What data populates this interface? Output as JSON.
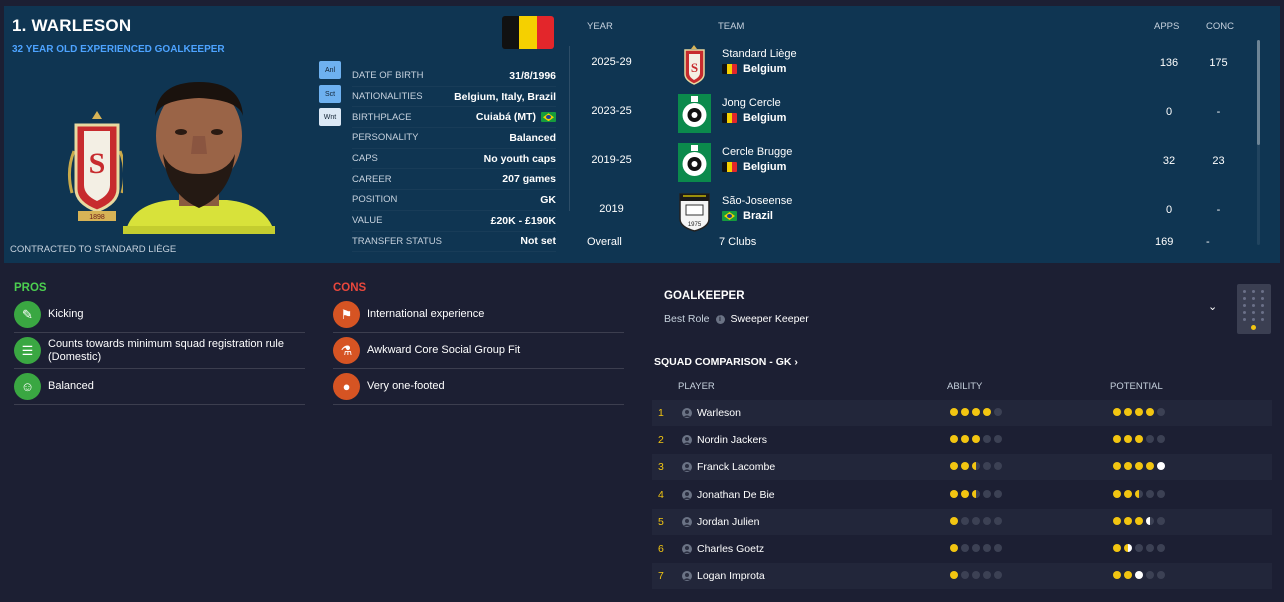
{
  "player": {
    "name": "1. WARLESON",
    "subtitle": "32 YEAR OLD EXPERIENCED GOALKEEPER",
    "contracted": "CONTRACTED TO STANDARD LIÈGE"
  },
  "badges": [
    "Anl",
    "Sct",
    "Wnt"
  ],
  "info": [
    {
      "label": "DATE OF BIRTH",
      "value": "31/8/1996"
    },
    {
      "label": "NATIONALITIES",
      "value": "Belgium, Italy, Brazil"
    },
    {
      "label": "BIRTHPLACE",
      "value": "Cuiabá (MT)",
      "flag": "brazil"
    },
    {
      "label": "PERSONALITY",
      "value": "Balanced"
    },
    {
      "label": "CAPS",
      "value": "No youth caps"
    },
    {
      "label": "CAREER",
      "value": "207  games"
    },
    {
      "label": "POSITION",
      "value": "GK"
    },
    {
      "label": "VALUE",
      "value": "£20K - £190K"
    },
    {
      "label": "TRANSFER STATUS",
      "value": "Not set"
    }
  ],
  "career": {
    "headers": {
      "year": "YEAR",
      "team": "TEAM",
      "apps": "APPS",
      "conc": "CONC"
    },
    "rows": [
      {
        "year": "2025-29",
        "team": "Standard Liège",
        "nation": "Belgium",
        "apps": "136",
        "conc": "175",
        "crest": "standard"
      },
      {
        "year": "2023-25",
        "team": "Jong Cercle",
        "nation": "Belgium",
        "apps": "0",
        "conc": "-",
        "crest": "cercle"
      },
      {
        "year": "2019-25",
        "team": "Cercle Brugge",
        "nation": "Belgium",
        "apps": "32",
        "conc": "23",
        "crest": "cercle"
      },
      {
        "year": "2019",
        "team": "São-Joseense",
        "nation": "Brazil",
        "apps": "0",
        "conc": "-",
        "crest": "joseense"
      }
    ],
    "overall": {
      "label": "Overall",
      "clubs": "7 Clubs",
      "apps": "169",
      "conc": "-"
    }
  },
  "pros": {
    "title": "PROS",
    "items": [
      "Kicking",
      "Counts towards minimum squad registration rule (Domestic)",
      "Balanced"
    ]
  },
  "cons": {
    "title": "CONS",
    "items": [
      "International experience",
      "Awkward Core Social Group Fit",
      "Very one-footed"
    ]
  },
  "goalkeeper": {
    "title": "GOALKEEPER",
    "best_role_label": "Best Role",
    "best_role": "Sweeper Keeper"
  },
  "squad": {
    "title": "SQUAD COMPARISON - GK",
    "headers": {
      "player": "PLAYER",
      "ability": "ABILITY",
      "potential": "POTENTIAL"
    },
    "rows": [
      {
        "num": "1",
        "name": "Warleson",
        "ability": 4,
        "potential": 4
      },
      {
        "num": "2",
        "name": "Nordin Jackers",
        "ability": 3,
        "potential": 3
      },
      {
        "num": "3",
        "name": "Franck Lacombe",
        "ability": 2.5,
        "potential": 4,
        "potential_white": 1
      },
      {
        "num": "4",
        "name": "Jonathan De Bie",
        "ability": 2.5,
        "potential": 2.5,
        "potential_white": 0
      },
      {
        "num": "5",
        "name": "Jordan Julien",
        "ability": 1,
        "potential": 3,
        "potential_white": 0.5
      },
      {
        "num": "6",
        "name": "Charles Goetz",
        "ability": 1,
        "potential": 1.5,
        "potential_white": 0.5
      },
      {
        "num": "7",
        "name": "Logan Improta",
        "ability": 1,
        "potential": 2,
        "potential_white": 1
      }
    ]
  },
  "colors": {
    "background": "#1c1f33",
    "top_panel": "#0f3552",
    "accent_blue": "#4da3ff",
    "pros_green": "#4ccf50",
    "cons_red": "#e8473c",
    "star_gold": "#f2c511"
  }
}
